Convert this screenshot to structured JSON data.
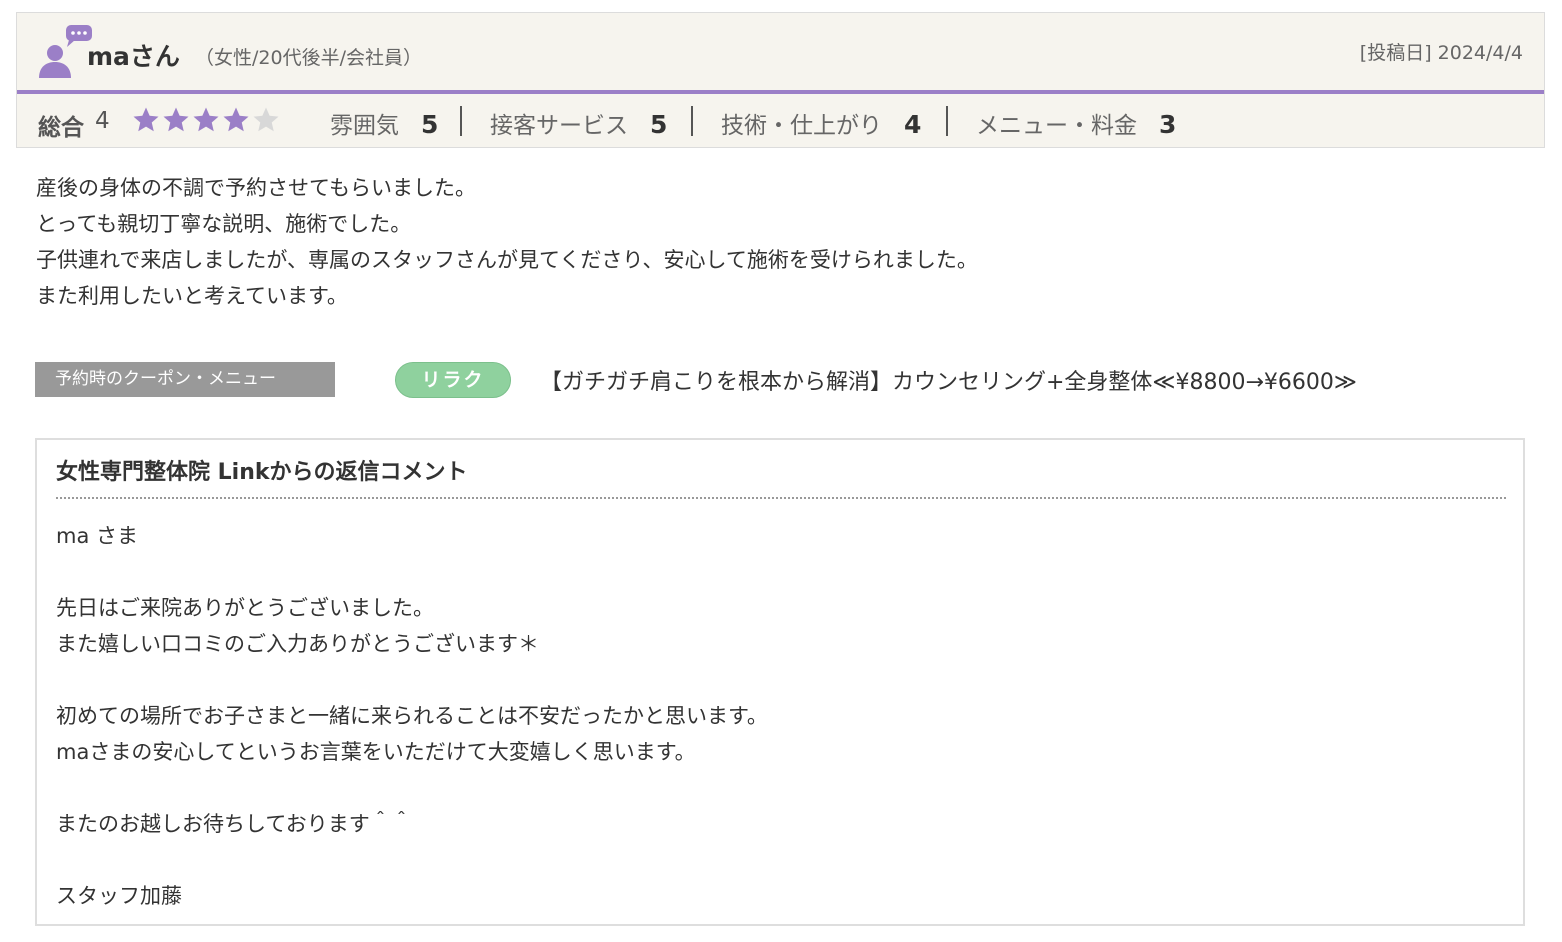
{
  "reviewer": {
    "name": "maさん",
    "meta": "（女性/20代後半/会社員）",
    "post_date": "[投稿日] 2024/4/4"
  },
  "colors": {
    "accent_purple": "#9b7fc7",
    "star_filled": "#9b7fc7",
    "star_empty": "#d8d8d8",
    "badge_green": "#8fd19e",
    "coupon_gray": "#999999"
  },
  "rating": {
    "overall_label": "総合",
    "overall_score": "4",
    "stars_filled": 4,
    "stars_total": 5,
    "categories": [
      {
        "label": "雰囲気",
        "value": "5"
      },
      {
        "label": "接客サービス",
        "value": "5"
      },
      {
        "label": "技術・仕上がり",
        "value": "4"
      },
      {
        "label": "メニュー・料金",
        "value": "3"
      }
    ]
  },
  "review_body": [
    "産後の身体の不調で予約させてもらいました。",
    "とっても親切丁寧な説明、施術でした。",
    "子供連れで来店しましたが、専属のスタッフさんが見てくださり、安心して施術を受けられました。",
    "また利用したいと考えています。"
  ],
  "coupon": {
    "tag_label": "予約時のクーポン・メニュー",
    "badge_label": "リラク",
    "title": "【ガチガチ肩こりを根本から解消】カウンセリング+全身整体≪¥8800→¥6600≫"
  },
  "reply": {
    "title": "女性専門整体院 Linkからの返信コメント",
    "lines": [
      "ma さま",
      "",
      "先日はご来院ありがとうございました。",
      "また嬉しい口コミのご入力ありがとうございます＊",
      "",
      "初めての場所でお子さまと一緒に来られることは不安だったかと思います。",
      "maさまの安心してというお言葉をいただけて大変嬉しく思います。",
      "",
      "またのお越しお待ちしております＾＾",
      "",
      "スタッフ加藤"
    ]
  },
  "icons": {
    "avatar": "user-with-speech-bubble-icon",
    "star": "star-icon"
  }
}
